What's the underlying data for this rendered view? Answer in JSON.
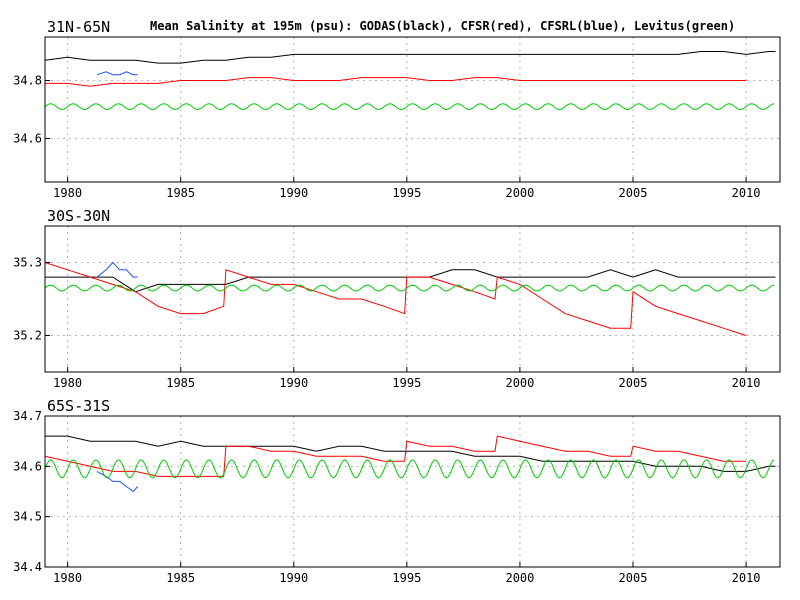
{
  "figure": {
    "title": "Mean Salinity at 195m (psu): GODAS(black), CFSR(red), CFSRL(blue), Levitus(green)"
  },
  "colors": {
    "GODAS": "#000000",
    "CFSR": "#ff0000",
    "CFSRL": "#1a50ff",
    "Levitus": "#00cc00",
    "grid": "#b4b4b4",
    "frame": "#000000"
  },
  "chart_data": [
    {
      "type": "line",
      "panel_label": "31N-65N",
      "xlim": [
        1979.0,
        2011.5
      ],
      "ylim": [
        34.45,
        34.95
      ],
      "xticks": [
        1980,
        1985,
        1990,
        1995,
        2000,
        2005,
        2010
      ],
      "yticks": [
        34.6,
        34.8
      ],
      "grid": true,
      "series": [
        {
          "name": "GODAS",
          "x": [
            1979.0,
            1980,
            1981,
            1982,
            1983,
            1984,
            1985,
            1986,
            1987,
            1988,
            1989,
            1990,
            1991,
            1992,
            1993,
            1994,
            1995,
            1996,
            1997,
            1998,
            1999,
            2000,
            2001,
            2002,
            2003,
            2004,
            2005,
            2006,
            2007,
            2008,
            2009,
            2010,
            2011,
            2011.3
          ],
          "y": [
            34.87,
            34.88,
            34.87,
            34.87,
            34.87,
            34.86,
            34.86,
            34.87,
            34.87,
            34.88,
            34.88,
            34.89,
            34.89,
            34.89,
            34.89,
            34.89,
            34.89,
            34.89,
            34.89,
            34.89,
            34.89,
            34.89,
            34.89,
            34.89,
            34.89,
            34.89,
            34.89,
            34.89,
            34.89,
            34.9,
            34.9,
            34.89,
            34.9,
            34.9
          ]
        },
        {
          "name": "CFSR",
          "x": [
            1979.0,
            1980,
            1981,
            1982,
            1983,
            1984,
            1985,
            1986,
            1987,
            1988,
            1989,
            1990,
            1991,
            1992,
            1993,
            1994,
            1995,
            1996,
            1997,
            1998,
            1999,
            2000,
            2001,
            2002,
            2003,
            2004,
            2005,
            2006,
            2007,
            2008,
            2009,
            2010
          ],
          "y": [
            34.79,
            34.79,
            34.78,
            34.79,
            34.79,
            34.79,
            34.8,
            34.8,
            34.8,
            34.81,
            34.81,
            34.8,
            34.8,
            34.8,
            34.81,
            34.81,
            34.81,
            34.8,
            34.8,
            34.81,
            34.81,
            34.8,
            34.8,
            34.8,
            34.8,
            34.8,
            34.8,
            34.8,
            34.8,
            34.8,
            34.8,
            34.8
          ]
        },
        {
          "name": "CFSRL",
          "x": [
            1981.3,
            1981.7,
            1982.0,
            1982.3,
            1982.6,
            1982.9,
            1983.1
          ],
          "y": [
            34.82,
            34.83,
            34.82,
            34.82,
            34.83,
            34.82,
            34.82
          ]
        },
        {
          "name": "Levitus",
          "periodic": true,
          "x_start": 1979.0,
          "x_end": 2011.3,
          "mean": 34.71,
          "amplitude": 0.01
        }
      ]
    },
    {
      "type": "line",
      "panel_label": "30S-30N",
      "xlim": [
        1979.0,
        2011.5
      ],
      "ylim": [
        35.15,
        35.35
      ],
      "xticks": [
        1980,
        1985,
        1990,
        1995,
        2000,
        2005,
        2010
      ],
      "yticks": [
        35.2,
        35.3
      ],
      "grid": true,
      "series": [
        {
          "name": "GODAS",
          "x": [
            1979.0,
            1980,
            1981,
            1982,
            1983,
            1984,
            1985,
            1986,
            1987,
            1988,
            1989,
            1990,
            1991,
            1992,
            1993,
            1994,
            1995,
            1996,
            1997,
            1998,
            1999,
            2000,
            2001,
            2002,
            2003,
            2004,
            2005,
            2006,
            2007,
            2008,
            2009,
            2010,
            2011,
            2011.3
          ],
          "y": [
            35.28,
            35.28,
            35.28,
            35.28,
            35.26,
            35.27,
            35.27,
            35.27,
            35.27,
            35.28,
            35.28,
            35.28,
            35.28,
            35.28,
            35.28,
            35.28,
            35.28,
            35.28,
            35.29,
            35.29,
            35.28,
            35.28,
            35.28,
            35.28,
            35.28,
            35.29,
            35.28,
            35.29,
            35.28,
            35.28,
            35.28,
            35.28,
            35.28,
            35.28
          ]
        },
        {
          "name": "CFSR",
          "x": [
            1979.0,
            1980,
            1981,
            1982,
            1983,
            1984,
            1985,
            1986,
            1986.9,
            1987.0,
            1988,
            1989,
            1990,
            1991,
            1992,
            1993,
            1994,
            1994.9,
            1995.0,
            1996,
            1997,
            1998,
            1998.9,
            1999.0,
            2000,
            2001,
            2002,
            2003,
            2004,
            2004.9,
            2005.0,
            2006,
            2007,
            2008,
            2009,
            2010
          ],
          "y": [
            35.3,
            35.29,
            35.28,
            35.27,
            35.26,
            35.24,
            35.23,
            35.23,
            35.24,
            35.29,
            35.28,
            35.27,
            35.27,
            35.26,
            35.25,
            35.25,
            35.24,
            35.23,
            35.28,
            35.28,
            35.27,
            35.26,
            35.25,
            35.28,
            35.27,
            35.25,
            35.23,
            35.22,
            35.21,
            35.21,
            35.26,
            35.24,
            35.23,
            35.22,
            35.21,
            35.2
          ]
        },
        {
          "name": "CFSRL",
          "x": [
            1981.3,
            1981.7,
            1982.0,
            1982.3,
            1982.6,
            1982.9,
            1983.1
          ],
          "y": [
            35.28,
            35.29,
            35.3,
            35.29,
            35.29,
            35.28,
            35.28
          ]
        },
        {
          "name": "Levitus",
          "periodic": true,
          "x_start": 1979.0,
          "x_end": 2011.3,
          "mean": 35.265,
          "amplitude": 0.004
        }
      ]
    },
    {
      "type": "line",
      "panel_label": "65S-31S",
      "xlim": [
        1979.0,
        2011.5
      ],
      "ylim": [
        34.4,
        34.7
      ],
      "xticks": [
        1980,
        1985,
        1990,
        1995,
        2000,
        2005,
        2010
      ],
      "yticks": [
        34.4,
        34.5,
        34.6,
        34.7
      ],
      "grid": true,
      "series": [
        {
          "name": "GODAS",
          "x": [
            1979.0,
            1980,
            1981,
            1982,
            1983,
            1984,
            1985,
            1986,
            1987,
            1988,
            1989,
            1990,
            1991,
            1992,
            1993,
            1994,
            1995,
            1996,
            1997,
            1998,
            1999,
            2000,
            2001,
            2002,
            2003,
            2004,
            2005,
            2006,
            2007,
            2008,
            2009,
            2010,
            2011,
            2011.3
          ],
          "y": [
            34.66,
            34.66,
            34.65,
            34.65,
            34.65,
            34.64,
            34.65,
            34.64,
            34.64,
            34.64,
            34.64,
            34.64,
            34.63,
            34.64,
            34.64,
            34.63,
            34.63,
            34.63,
            34.63,
            34.62,
            34.62,
            34.62,
            34.61,
            34.61,
            34.61,
            34.61,
            34.61,
            34.6,
            34.6,
            34.6,
            34.59,
            34.59,
            34.6,
            34.6
          ]
        },
        {
          "name": "CFSR",
          "x": [
            1979.0,
            1980,
            1981,
            1982,
            1983,
            1984,
            1985,
            1986,
            1986.9,
            1987.0,
            1988,
            1989,
            1990,
            1991,
            1992,
            1993,
            1994,
            1994.9,
            1995.0,
            1996,
            1997,
            1998,
            1998.9,
            1999.0,
            2000,
            2001,
            2002,
            2003,
            2004,
            2004.9,
            2005.0,
            2006,
            2007,
            2008,
            2009,
            2010
          ],
          "y": [
            34.62,
            34.61,
            34.6,
            34.59,
            34.59,
            34.58,
            34.58,
            34.58,
            34.58,
            34.64,
            34.64,
            34.63,
            34.63,
            34.62,
            34.62,
            34.62,
            34.61,
            34.61,
            34.65,
            34.64,
            34.64,
            34.63,
            34.63,
            34.66,
            34.65,
            34.64,
            34.63,
            34.63,
            34.62,
            34.62,
            34.64,
            34.63,
            34.63,
            34.62,
            34.61,
            34.61
          ]
        },
        {
          "name": "CFSRL",
          "x": [
            1981.3,
            1981.7,
            1982.0,
            1982.3,
            1982.6,
            1982.9,
            1983.1
          ],
          "y": [
            34.59,
            34.58,
            34.57,
            34.57,
            34.56,
            34.55,
            34.56
          ]
        },
        {
          "name": "Levitus",
          "periodic": true,
          "x_start": 1979.0,
          "x_end": 2011.3,
          "mean": 34.595,
          "amplitude": 0.018
        }
      ]
    }
  ]
}
